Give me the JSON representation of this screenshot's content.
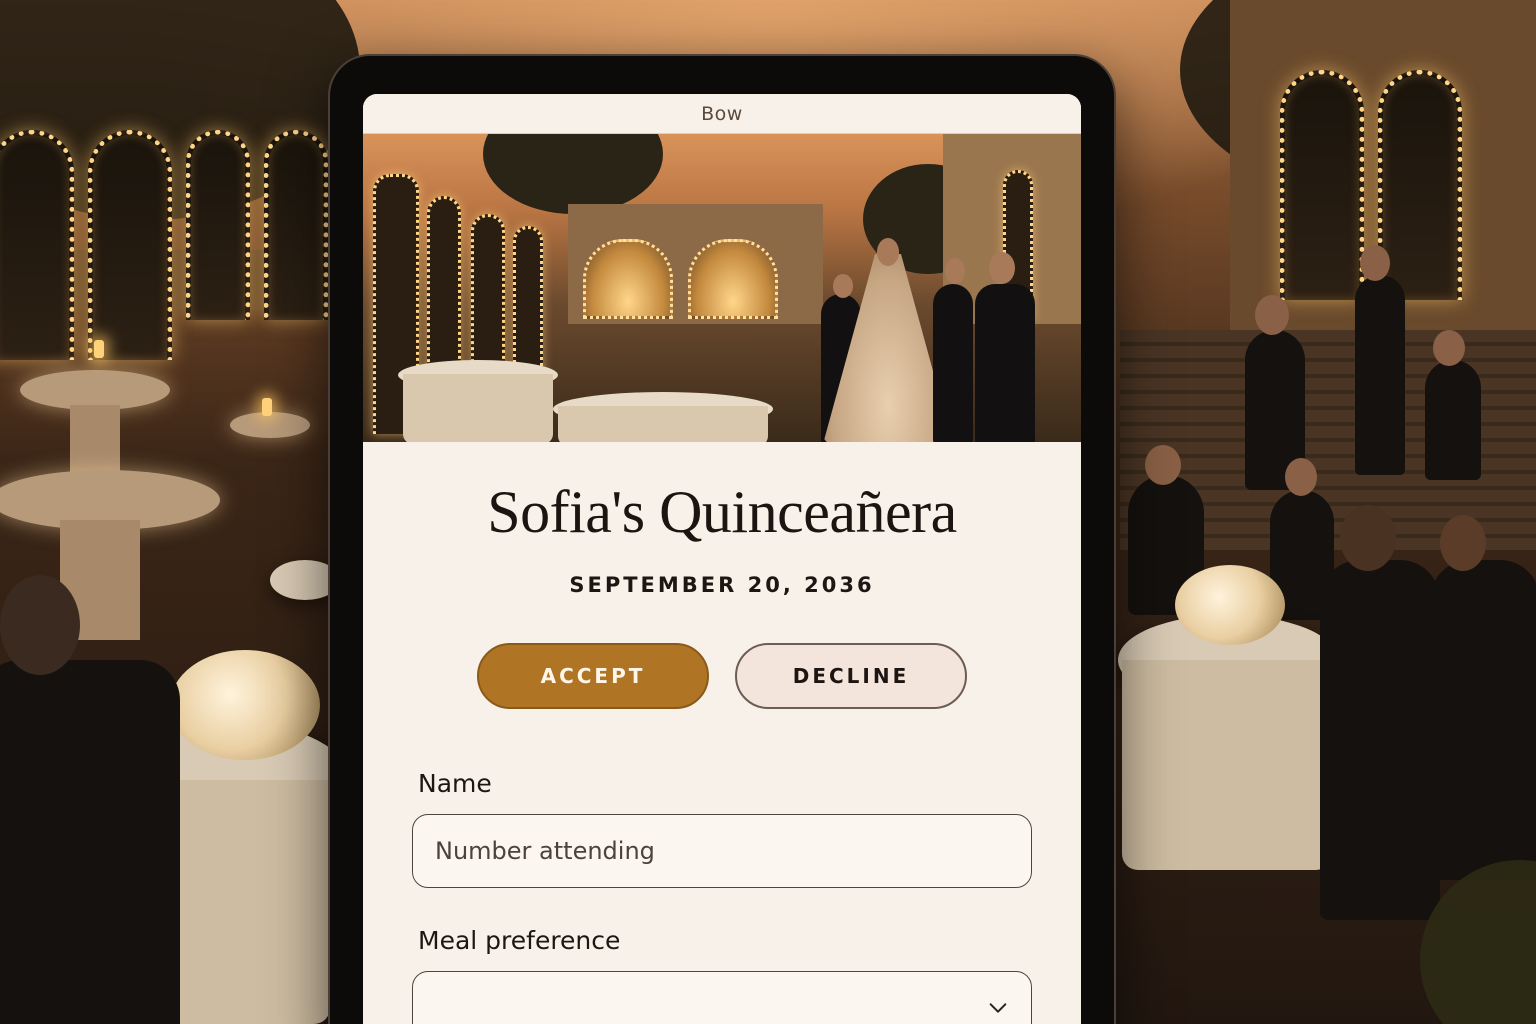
{
  "status_bar": {
    "title": "Bow"
  },
  "event": {
    "title": "Sofia's Quinceañera",
    "date": "SEPTEMBER 20, 2036"
  },
  "rsvp": {
    "accept_label": "ACCEPT",
    "decline_label": "DECLINE",
    "accent_color": "#b07425"
  },
  "form": {
    "name_label": "Name",
    "name_placeholder": "Number attending",
    "meal_label": "Meal preference",
    "meal_value": "",
    "meal_icon": "chevron-down-icon"
  }
}
